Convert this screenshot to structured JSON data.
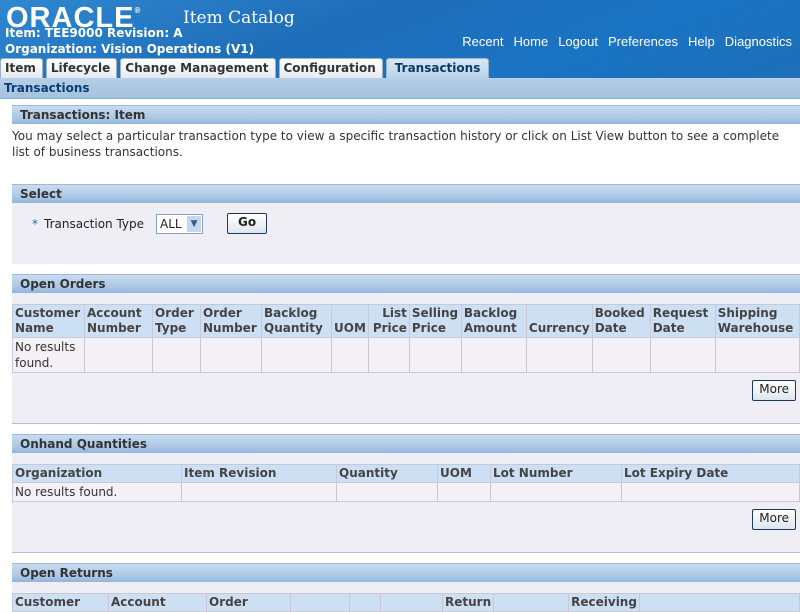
{
  "header": {
    "logo": "ORACLE",
    "app_title": "Item Catalog",
    "item_line": "Item: TEE9000  Revision: A",
    "org_line": "Organization: Vision Operations (V1)",
    "global_links": [
      "Recent",
      "Home",
      "Logout",
      "Preferences",
      "Help",
      "Diagnostics"
    ],
    "tabs": [
      {
        "label": "Item",
        "active": false
      },
      {
        "label": "Lifecycle",
        "active": false
      },
      {
        "label": "Change Management",
        "active": false
      },
      {
        "label": "Configuration",
        "active": false
      },
      {
        "label": "Transactions",
        "active": true
      }
    ]
  },
  "subtab": "Transactions",
  "page": {
    "title": "Transactions: Item",
    "intro": "You may select a particular transaction type to view a specific transaction history or click on List View button to see a complete list of business transactions."
  },
  "select": {
    "title": "Select",
    "required_marker": "*",
    "field_label": "Transaction Type",
    "value": "ALL",
    "go_label": "Go"
  },
  "open_orders": {
    "title": "Open Orders",
    "columns": [
      "Customer Name",
      "Account Number",
      "Order Type",
      "Order Number",
      "Backlog Quantity",
      "UOM",
      "List Price",
      "Selling Price",
      "Backlog Amount",
      "Currency",
      "Booked Date",
      "Request Date",
      "Shipping Warehouse"
    ],
    "empty_text": "No results found.",
    "more_label": "More"
  },
  "onhand": {
    "title": "Onhand Quantities",
    "columns": [
      "Organization",
      "Item Revision",
      "Quantity",
      "UOM",
      "Lot Number",
      "Lot Expiry Date"
    ],
    "empty_text": "No results found.",
    "more_label": "More"
  },
  "open_returns": {
    "title": "Open Returns",
    "columns": [
      "Customer",
      "Account",
      "Order",
      "",
      "",
      "",
      "Return",
      "",
      "Receiving"
    ]
  },
  "colors": {
    "header_blue": "#1f6db8",
    "subtab_blue": "#a4c2de",
    "section_header": "#a9c6e4",
    "table_header": "#cde0f3",
    "panel_bg": "#eeeef4"
  }
}
